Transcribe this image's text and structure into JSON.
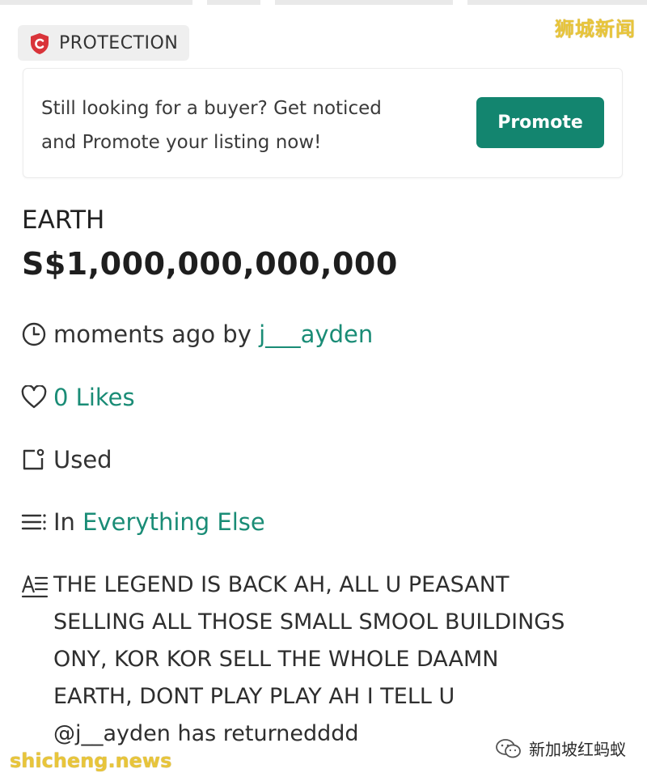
{
  "watermarks": {
    "top": "狮城新闻",
    "bottom": "shicheng.news",
    "wechat": "新加坡红蚂蚁"
  },
  "protection": {
    "label": "PROTECTION",
    "icon": "shield-icon"
  },
  "promo": {
    "line1": "Still looking for a buyer? Get noticed",
    "line2": "and Promote your listing now!",
    "button": "Promote"
  },
  "listing": {
    "title": "EARTH",
    "price": "S$1,000,000,000,000",
    "posted_prefix": "moments ago by ",
    "seller": "j___ayden",
    "likes": "0 Likes",
    "condition": "Used",
    "category_prefix": "In ",
    "category": "Everything Else",
    "description": "THE LEGEND IS BACK AH, ALL U PEASANT\nSELLING ALL THOSE SMALL SMOOL BUILDINGS\nONY, KOR KOR SELL THE WHOLE DAAMN\nEARTH, DONT PLAY PLAY AH I TELL U\n@j__ayden has returnedddd"
  },
  "colors": {
    "accent": "#13856f",
    "link": "#1a8c76",
    "shield": "#d9343a"
  }
}
